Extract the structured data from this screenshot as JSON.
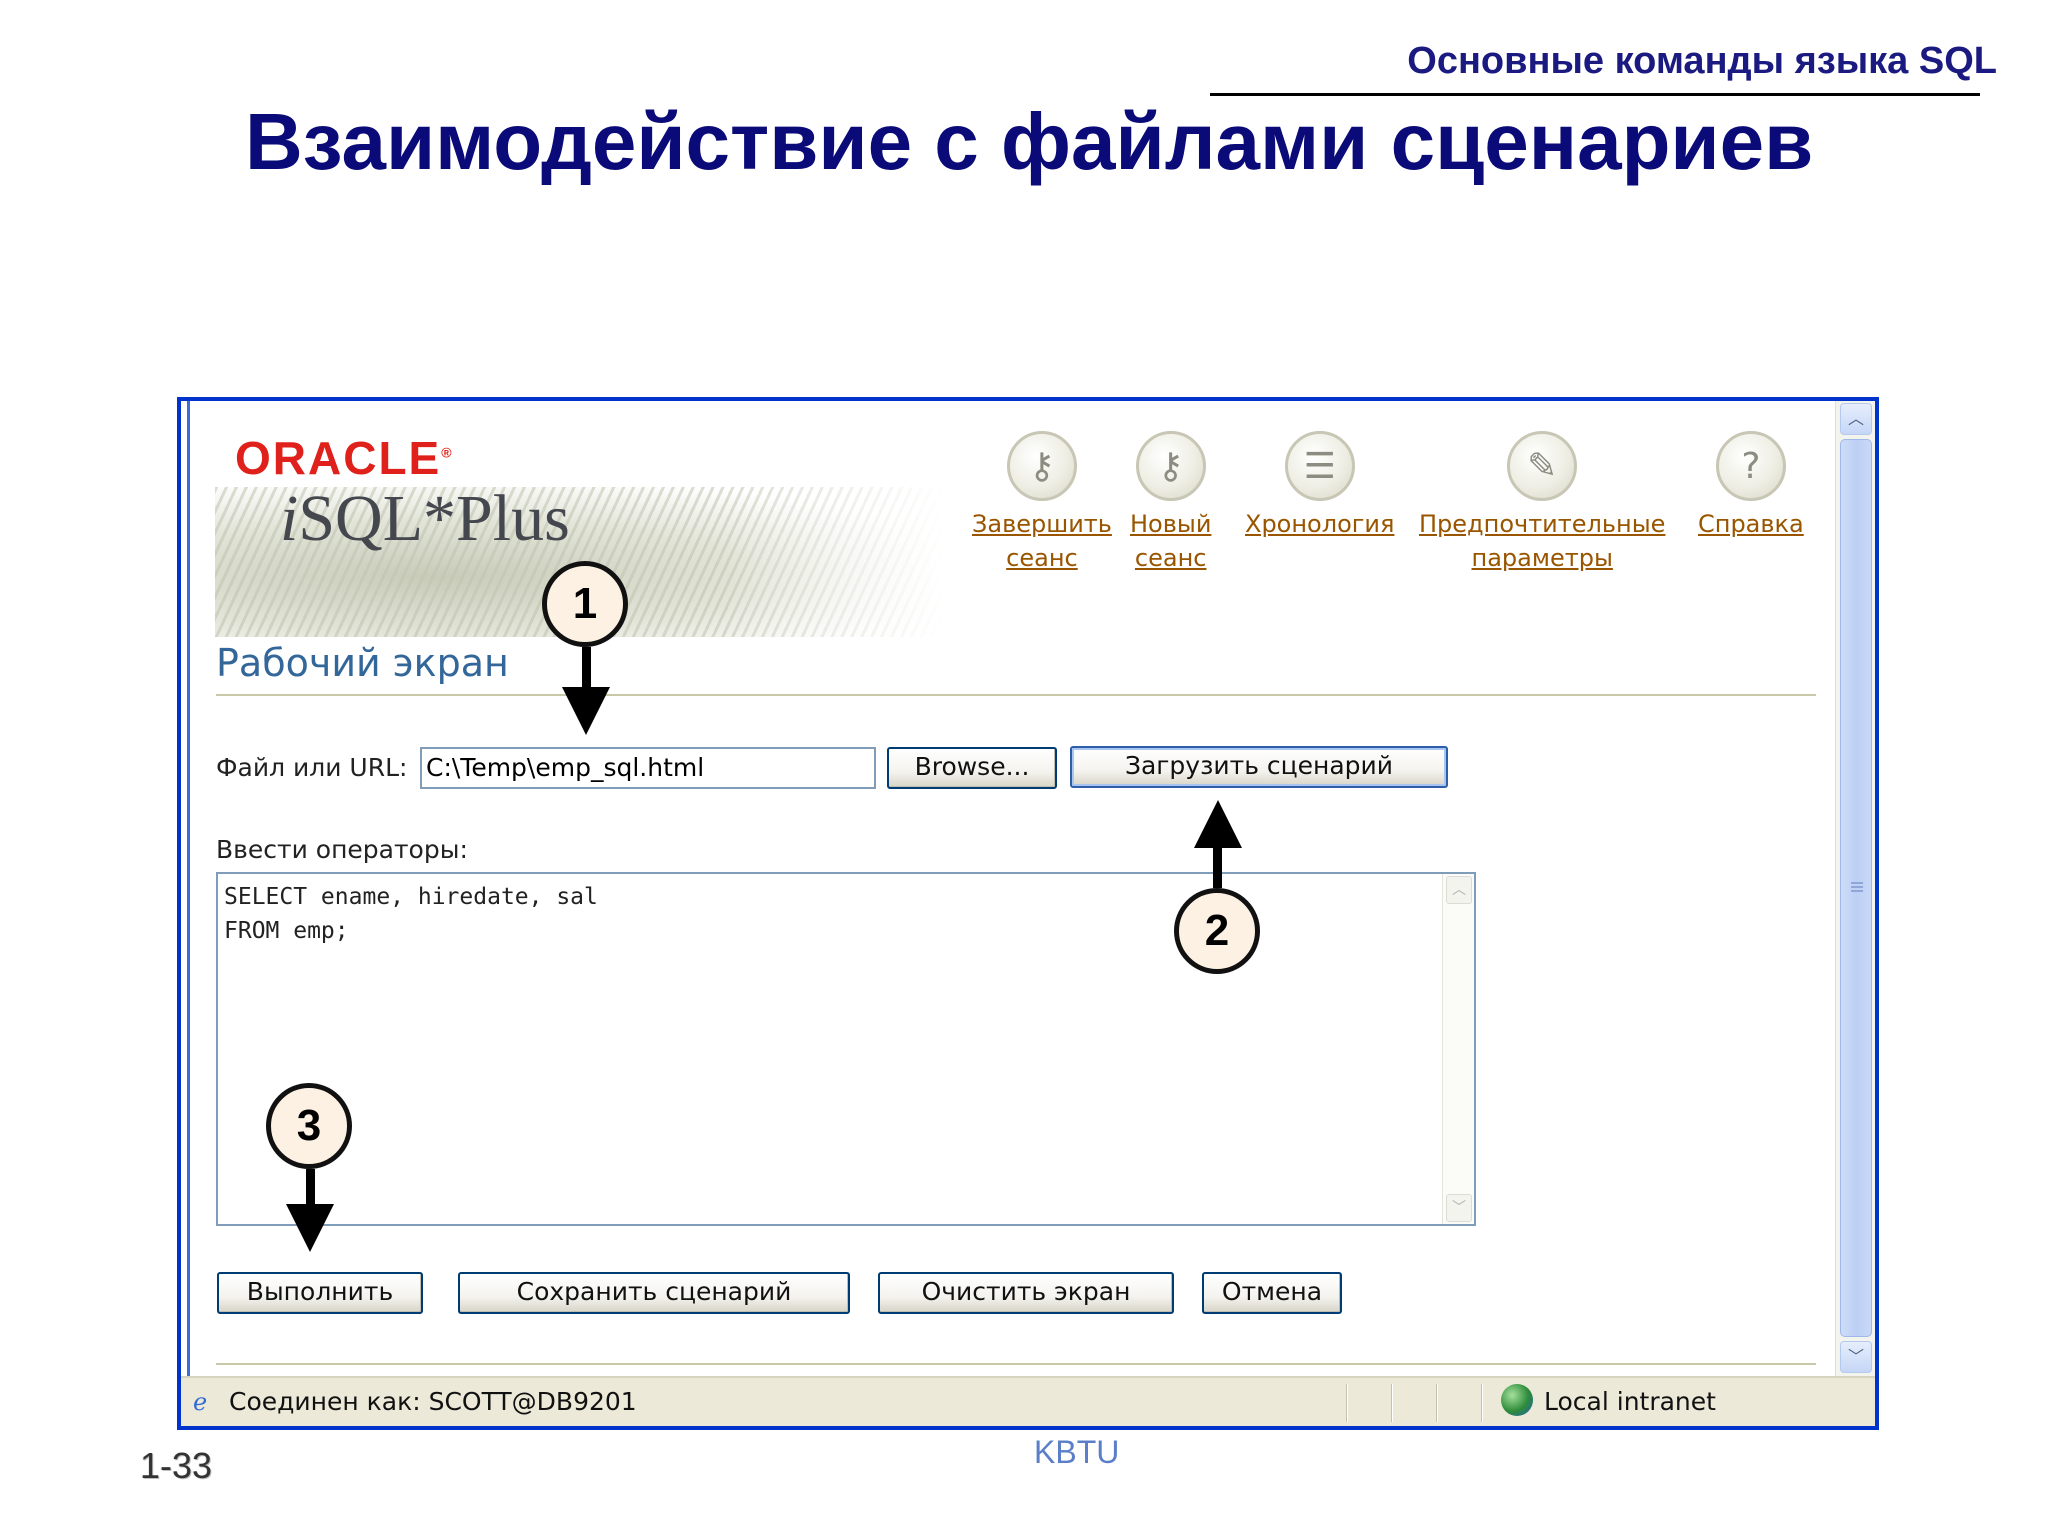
{
  "slide": {
    "subtitle": "Основные команды языка SQL",
    "title": "Взаимодействие с файлами сценариев",
    "page_number": "1-33",
    "footer_org": "KBTU"
  },
  "app": {
    "logo": "ORACLE",
    "product_name_prefix": "i",
    "product_name_rest": "SQL*Plus",
    "toolbar": [
      {
        "label": "Завершить\nсеанс",
        "icon": "logout-key-icon"
      },
      {
        "label": "Новый\nсеанс",
        "icon": "key-icon"
      },
      {
        "label": "Хронология",
        "icon": "history-icon"
      },
      {
        "label": "Предпочтительные\nпараметры",
        "icon": "preferences-icon"
      },
      {
        "label": "Справка",
        "icon": "help-icon"
      }
    ],
    "section_title": "Рабочий экран",
    "file_label": "Файл или URL:",
    "file_value": "C:\\Temp\\emp_sql.html",
    "browse_label": "Browse...",
    "load_label": "Загрузить сценарий",
    "statements_label": "Ввести операторы:",
    "sql_text": "SELECT ename, hiredate, sal\nFROM emp;",
    "buttons": {
      "execute": "Выполнить",
      "save": "Сохранить сценарий",
      "clear": "Очистить экран",
      "cancel": "Отмена"
    },
    "status": {
      "connection": "Соединен как: SCOTT@DB9201",
      "zone": "Local intranet"
    }
  },
  "callouts": [
    "1",
    "2",
    "3"
  ],
  "colors": {
    "title": "#0a0a78",
    "oracle_red": "#e0201a",
    "link": "#995500",
    "section": "#336699",
    "window_border": "#0033cc"
  }
}
